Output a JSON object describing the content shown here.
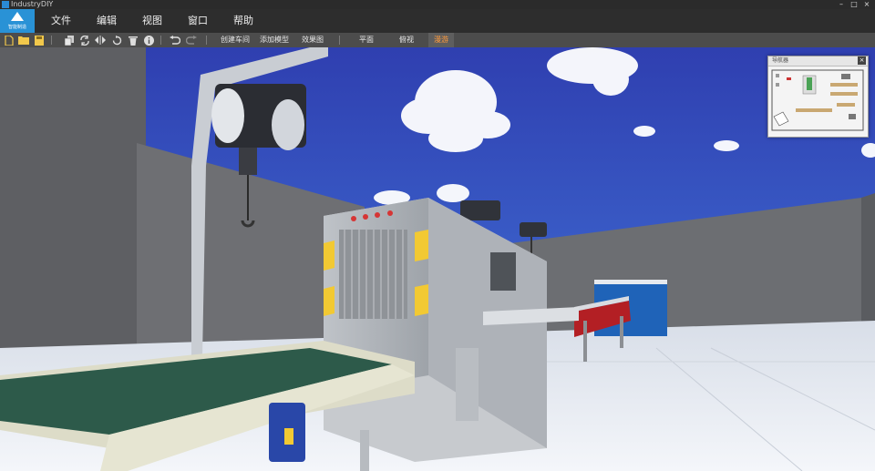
{
  "app": {
    "title": "IndustryDIY",
    "logo_text": "智能制造"
  },
  "window_controls": {
    "minimize": "–",
    "maximize": "□",
    "close": "×"
  },
  "menu": [
    "文件",
    "编辑",
    "视图",
    "窗口",
    "帮助"
  ],
  "toolbar": {
    "icons": [
      "new-file-icon",
      "open-folder-icon",
      "save-icon",
      "copy-icon",
      "refresh-icon",
      "mirror-icon",
      "rotate-icon",
      "delete-icon",
      "info-icon",
      "undo-icon",
      "redo-icon"
    ],
    "actions": [
      "创建车间",
      "添加模型",
      "效果图"
    ],
    "views": [
      "平面",
      "俯视",
      "漫游"
    ],
    "active_view": "漫游"
  },
  "minimap": {
    "title": "导航器",
    "close": "×"
  },
  "colors": {
    "accent": "#2992d6",
    "active_view": "#ff9a3c"
  }
}
